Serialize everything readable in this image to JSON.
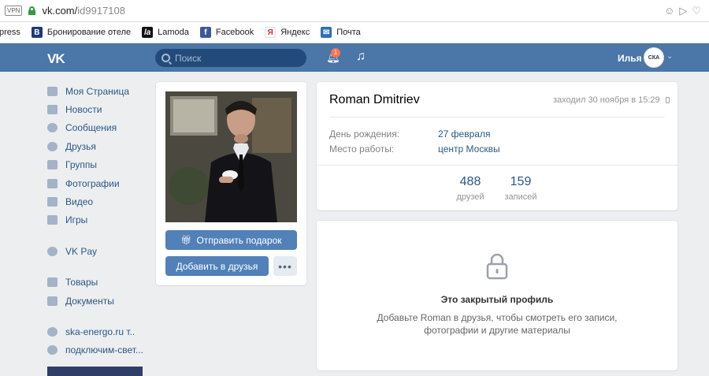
{
  "browser": {
    "vpn_label": "VPN",
    "url_host": "vk.com/",
    "url_path": "id9917108"
  },
  "bookmarks": [
    {
      "label": "press",
      "icon": "none",
      "color": "#ffffff"
    },
    {
      "label": "Бронирование отеле",
      "icon": "booking-icon",
      "color": "#1b3a79"
    },
    {
      "label": "Lamoda",
      "icon": "lamoda-icon",
      "color": "#111111"
    },
    {
      "label": "Facebook",
      "icon": "facebook-icon",
      "color": "#3b5998"
    },
    {
      "label": "Яндекс",
      "icon": "yandex-icon",
      "color": "#ffffff"
    },
    {
      "label": "Почта",
      "icon": "mail-icon",
      "color": "#2f6fb8"
    }
  ],
  "header": {
    "logo": "VK",
    "search_placeholder": "Поиск",
    "notification_count": "1",
    "user_name": "Илья",
    "avatar_text": "СКА"
  },
  "menu": {
    "main": [
      {
        "label": "Моя Страница",
        "icon": "home-icon"
      },
      {
        "label": "Новости",
        "icon": "news-icon"
      },
      {
        "label": "Сообщения",
        "icon": "messages-icon"
      },
      {
        "label": "Друзья",
        "icon": "friends-icon"
      },
      {
        "label": "Группы",
        "icon": "groups-icon"
      },
      {
        "label": "Фотографии",
        "icon": "camera-icon"
      },
      {
        "label": "Видео",
        "icon": "video-icon"
      },
      {
        "label": "Игры",
        "icon": "gamepad-icon"
      }
    ],
    "pay": [
      {
        "label": "VK Pay",
        "icon": "vkpay-icon"
      }
    ],
    "extra": [
      {
        "label": "Товары",
        "icon": "bag-icon"
      },
      {
        "label": "Документы",
        "icon": "document-icon"
      }
    ],
    "groups": [
      {
        "label": "ska-energo.ru т..",
        "icon": "community-icon"
      },
      {
        "label": "подключим-свет...",
        "icon": "community-icon"
      }
    ]
  },
  "profile": {
    "gift_button": "Отправить подарок",
    "add_friend_button": "Добавить в друзья",
    "more_button": "•••",
    "name": "Roman Dmitriev",
    "last_seen": "заходил 30 ноября в 15:29",
    "fields": [
      {
        "label": "День рождения:",
        "value": "27 февраля"
      },
      {
        "label": "Место работы:",
        "value": "центр Москвы"
      }
    ],
    "counters": [
      {
        "number": "488",
        "label": "друзей"
      },
      {
        "number": "159",
        "label": "записей"
      }
    ],
    "closed_title": "Это закрытый профиль",
    "closed_text_1": "Добавьте Roman в друзья, чтобы смотреть его записи,",
    "closed_text_2": "фотографии и другие материалы"
  }
}
